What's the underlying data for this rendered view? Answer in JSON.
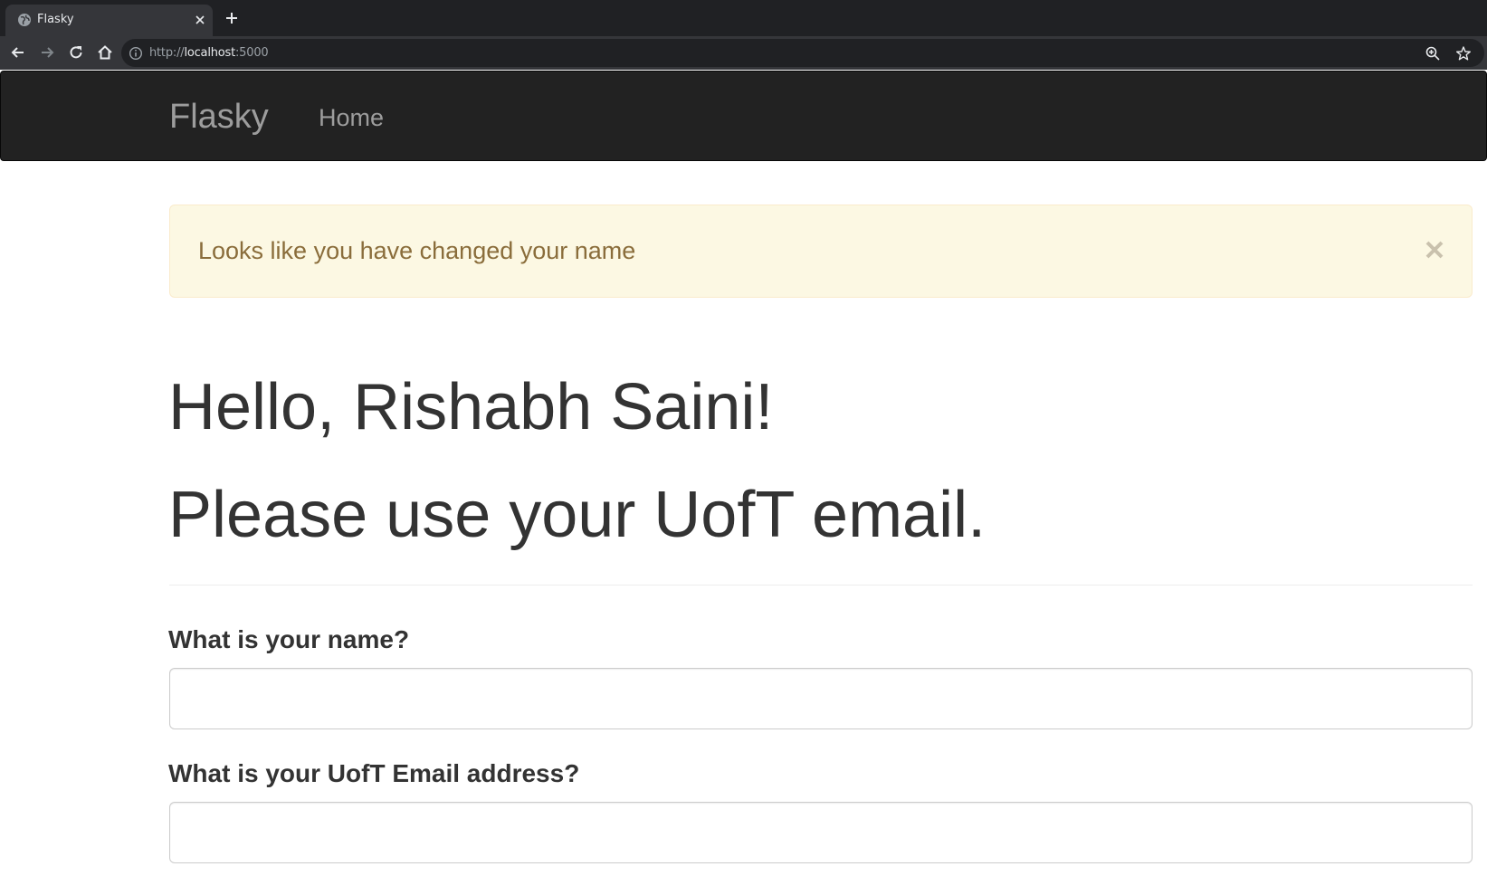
{
  "browser": {
    "tab": {
      "title": "Flasky"
    },
    "address": {
      "scheme": "http://",
      "host": "localhost",
      "port": ":5000"
    },
    "icons": [
      "globe-icon",
      "close-icon",
      "plus-icon",
      "back-arrow-icon",
      "forward-arrow-icon",
      "reload-icon",
      "home-icon",
      "info-icon",
      "zoom-icon",
      "star-icon"
    ]
  },
  "navbar": {
    "brand": "Flasky",
    "links": [
      {
        "label": "Home"
      }
    ]
  },
  "alert": {
    "message": "Looks like you have changed your name",
    "close_symbol": "×"
  },
  "main": {
    "greeting": "Hello, Rishabh Saini!",
    "notice": "Please use your UofT email."
  },
  "form": {
    "name_label": "What is your name?",
    "name_value": "",
    "email_label": "What is your UofT Email address?",
    "email_value": ""
  },
  "colors": {
    "navbar_bg": "#222222",
    "navbar_text": "#9d9d9d",
    "alert_bg": "#fcf8e3",
    "alert_border": "#faebcc",
    "alert_text": "#8a6d3b",
    "body_text": "#333333"
  }
}
